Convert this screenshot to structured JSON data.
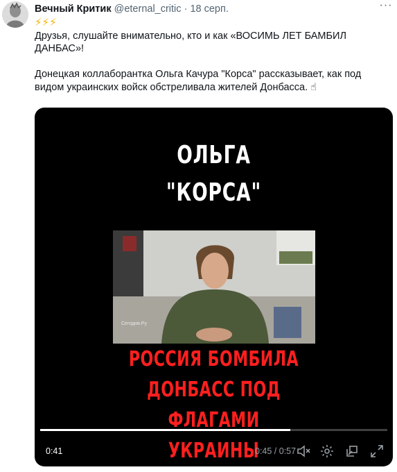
{
  "tweet": {
    "author_name": "Вечный Критик",
    "author_handle": "@eternal_critic",
    "separator": "·",
    "date": "18 серп.",
    "more_label": "···",
    "emoji_line": "⚡⚡⚡",
    "line1": "Друзья, слушайте внимательно, кто и как «ВОСИМЬ ЛЕТ БАМБИЛ ДАНБАС»!",
    "line2": "Донецкая коллаборантка Ольга Качура \"Корса\" рассказывает, как под видом украинских войск обстреливала жителей Донбасса. ☝"
  },
  "video": {
    "title_line1": "ОЛЬГА",
    "title_line2": "\"КОРСА\"",
    "caption_line1": "РОССИЯ БОМБИЛА",
    "caption_line2": "ДОНБАСС ПОД",
    "caption_line3": "ФЛАГАМИ",
    "caption_line4": "УКРАИНЫ",
    "still_watermark": "Сегодня.Ру",
    "current_time": "0:41",
    "duration_text": "0:45 / 0:57",
    "progress_fraction": 0.72,
    "colors": {
      "title": "#ffffff",
      "caption": "#ff1f1f",
      "background": "#000000"
    }
  },
  "icons": [
    "avatar",
    "more-icon",
    "volume-off-icon",
    "settings-icon",
    "picture-in-picture-icon",
    "fullscreen-icon"
  ]
}
